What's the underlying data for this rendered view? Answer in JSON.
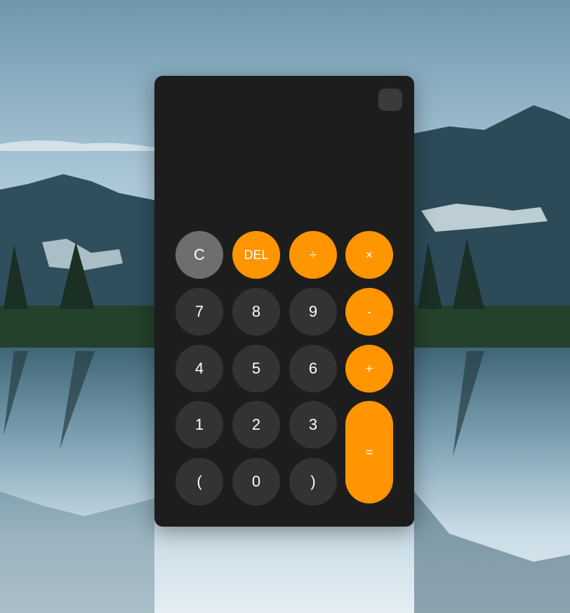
{
  "calculator": {
    "display": "",
    "keys": {
      "clear": "C",
      "delete": "DEL",
      "divide": "÷",
      "multiply": "×",
      "seven": "7",
      "eight": "8",
      "nine": "9",
      "minus": "-",
      "four": "4",
      "five": "5",
      "six": "6",
      "plus": "+",
      "one": "1",
      "two": "2",
      "three": "3",
      "equals": "=",
      "open_paren": "(",
      "zero": "0",
      "close_paren": ")"
    }
  },
  "colors": {
    "panel": "#1d1d1d",
    "number_key": "#333333",
    "operator_key": "#ff9500",
    "clear_key": "#6e6e6e",
    "text": "#ffffff"
  },
  "background": "mountain-lake-landscape"
}
